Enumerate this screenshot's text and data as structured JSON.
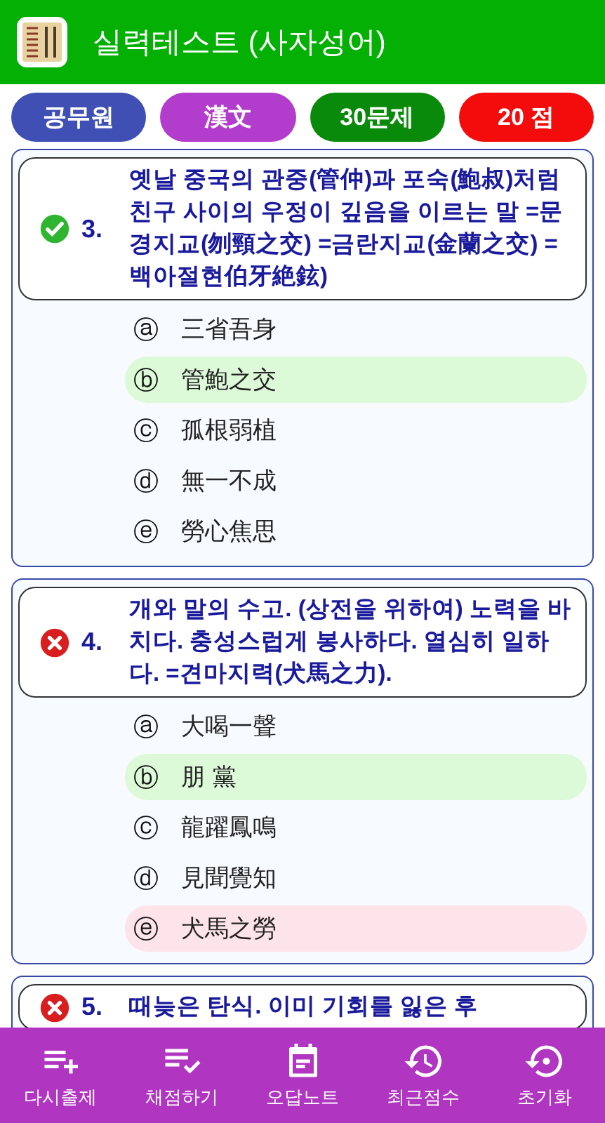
{
  "app_bar": {
    "title": "실력테스트 (사자성어)"
  },
  "chips": [
    {
      "label": "공무원",
      "color": "#3f4fb4"
    },
    {
      "label": "漢文",
      "color": "#b23ccc"
    },
    {
      "label": "30문제",
      "color": "#0a8a0a"
    },
    {
      "label": "20 점",
      "color": "#f40b0b"
    }
  ],
  "questions": [
    {
      "number": "3.",
      "kind": "correct",
      "text": "옛날 중국의 관중(管仲)과 포숙(鮑叔)처럼 친구 사이의 우정이 깊음을 이르는 말 =문경지교(刎頸之交) =금란지교(金蘭之交) =백아절현伯牙絶鉉)",
      "options": [
        {
          "letter": "ⓐ",
          "text": "三省吾身",
          "kind": "plain"
        },
        {
          "letter": "ⓑ",
          "text": "管鮑之交",
          "kind": "correct"
        },
        {
          "letter": "ⓒ",
          "text": "孤根弱植",
          "kind": "plain"
        },
        {
          "letter": "ⓓ",
          "text": "無一不成",
          "kind": "plain"
        },
        {
          "letter": "ⓔ",
          "text": "勞心焦思",
          "kind": "plain"
        }
      ]
    },
    {
      "number": "4.",
      "kind": "wrong",
      "text": "개와 말의 수고. (상전을 위하여) 노력을 바치다. 충성스럽게 봉사하다. 열심히 일하다. =견마지력(犬馬之力).",
      "options": [
        {
          "letter": "ⓐ",
          "text": "大喝一聲",
          "kind": "plain"
        },
        {
          "letter": "ⓑ",
          "text": "朋 黨",
          "kind": "correct"
        },
        {
          "letter": "ⓒ",
          "text": "龍躍鳳鳴",
          "kind": "plain"
        },
        {
          "letter": "ⓓ",
          "text": "見聞覺知",
          "kind": "plain"
        },
        {
          "letter": "ⓔ",
          "text": "犬馬之勞",
          "kind": "wrong"
        }
      ]
    },
    {
      "number": "5.",
      "kind": "wrong",
      "text": "때늦은 탄식. 이미 기회를 잃은 후"
    }
  ],
  "bottom_nav": [
    {
      "label": "다시출제"
    },
    {
      "label": "채점하기"
    },
    {
      "label": "오답노트"
    },
    {
      "label": "최근점수"
    },
    {
      "label": "초기화"
    }
  ]
}
